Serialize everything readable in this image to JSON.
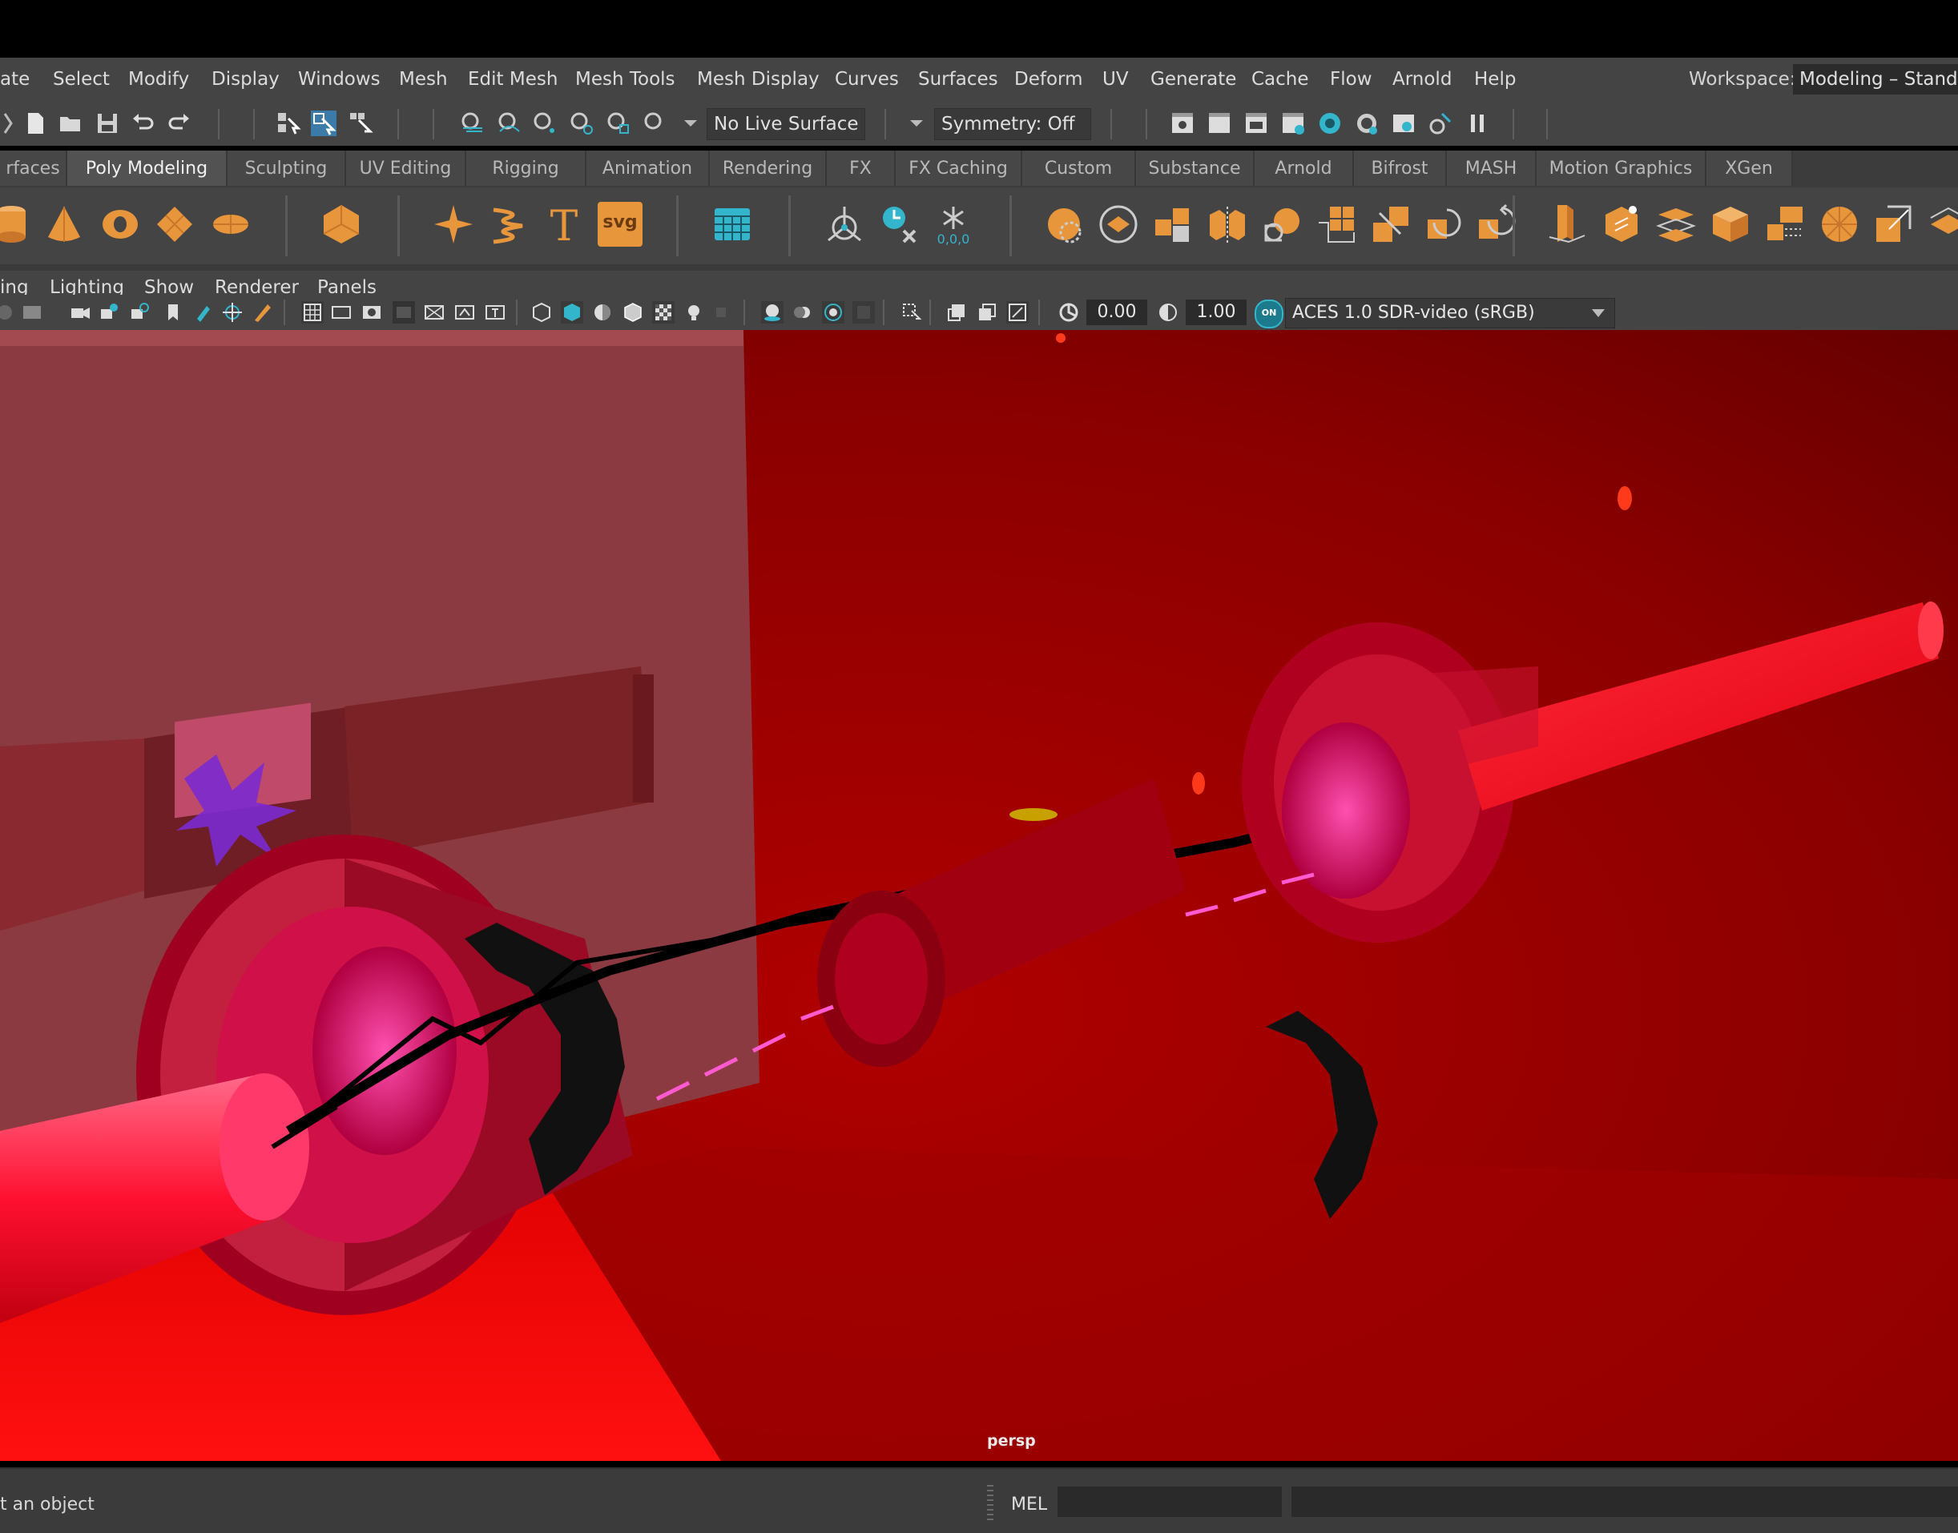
{
  "menubar": {
    "items": [
      "ate",
      "Select",
      "Modify",
      "Display",
      "Windows",
      "Mesh",
      "Edit Mesh",
      "Mesh Tools",
      "Mesh Display",
      "Curves",
      "Surfaces",
      "Deform",
      "UV",
      "Generate",
      "Cache",
      "Flow",
      "Arnold",
      "Help"
    ],
    "workspace_label": "Workspace:",
    "workspace_value": "Modeling – Standa"
  },
  "statusline": {
    "live_surface": "No Live Surface",
    "symmetry": "Symmetry: Off"
  },
  "shelf_tabs": {
    "items": [
      "rfaces",
      "Poly Modeling",
      "Sculpting",
      "UV Editing",
      "Rigging",
      "Animation",
      "Rendering",
      "FX",
      "FX Caching",
      "Custom",
      "Substance",
      "Arnold",
      "Bifrost",
      "MASH",
      "Motion Graphics",
      "XGen"
    ],
    "active": "Poly Modeling"
  },
  "shelf": {
    "text_tool_glyph": "T",
    "svg_tool_label": "svg",
    "snowflake_label": "0,0,0"
  },
  "panel_menu": {
    "items": [
      "ing",
      "Lighting",
      "Show",
      "Renderer",
      "Panels"
    ]
  },
  "panel_toolbar": {
    "exposure": "0.00",
    "gamma": "1.00",
    "color_mgmt_badge": "ON",
    "color_space": "ACES 1.0 SDR-video (sRGB)"
  },
  "viewport": {
    "camera": "persp"
  },
  "command_line": {
    "help_text": "t an object",
    "language": "MEL"
  },
  "colors": {
    "ui_bg": "#444444",
    "accent_orange": "#e8963c",
    "accent_cyan": "#33b5cc",
    "scene_red": "#c00000"
  }
}
